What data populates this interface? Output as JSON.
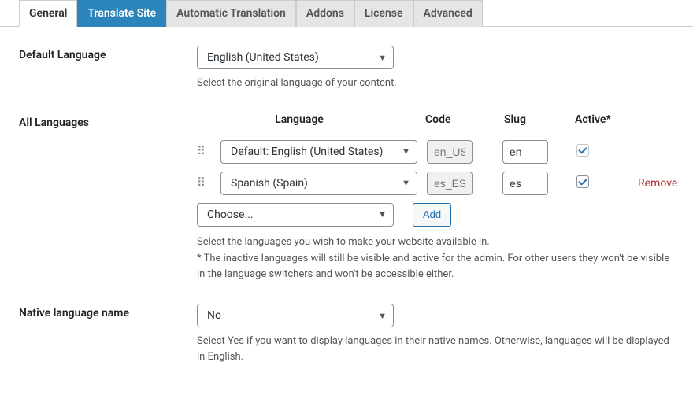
{
  "tabs": {
    "general": "General",
    "translate_site": "Translate Site",
    "automatic_translation": "Automatic Translation",
    "addons": "Addons",
    "license": "License",
    "advanced": "Advanced"
  },
  "default_language": {
    "label": "Default Language",
    "value": "English (United States)",
    "helper": "Select the original language of your content."
  },
  "all_languages": {
    "label": "All Languages",
    "headers": {
      "language": "Language",
      "code": "Code",
      "slug": "Slug",
      "active": "Active*"
    },
    "rows": [
      {
        "language": "Default: English (United States)",
        "code": "en_US",
        "slug": "en",
        "active": true,
        "removable": false,
        "draggable": true
      },
      {
        "language": "Spanish (Spain)",
        "code": "es_ES",
        "slug": "es",
        "active": true,
        "removable": true,
        "draggable": true
      }
    ],
    "choose_placeholder": "Choose...",
    "add_button": "Add",
    "remove_label": "Remove",
    "helper1": "Select the languages you wish to make your website available in.",
    "helper2": "* The inactive languages will still be visible and active for the admin. For other users they won't be visible in the language switchers and won't be accessible either."
  },
  "native_language_name": {
    "label": "Native language name",
    "value": "No",
    "helper": "Select Yes if you want to display languages in their native names. Otherwise, languages will be displayed in English."
  }
}
